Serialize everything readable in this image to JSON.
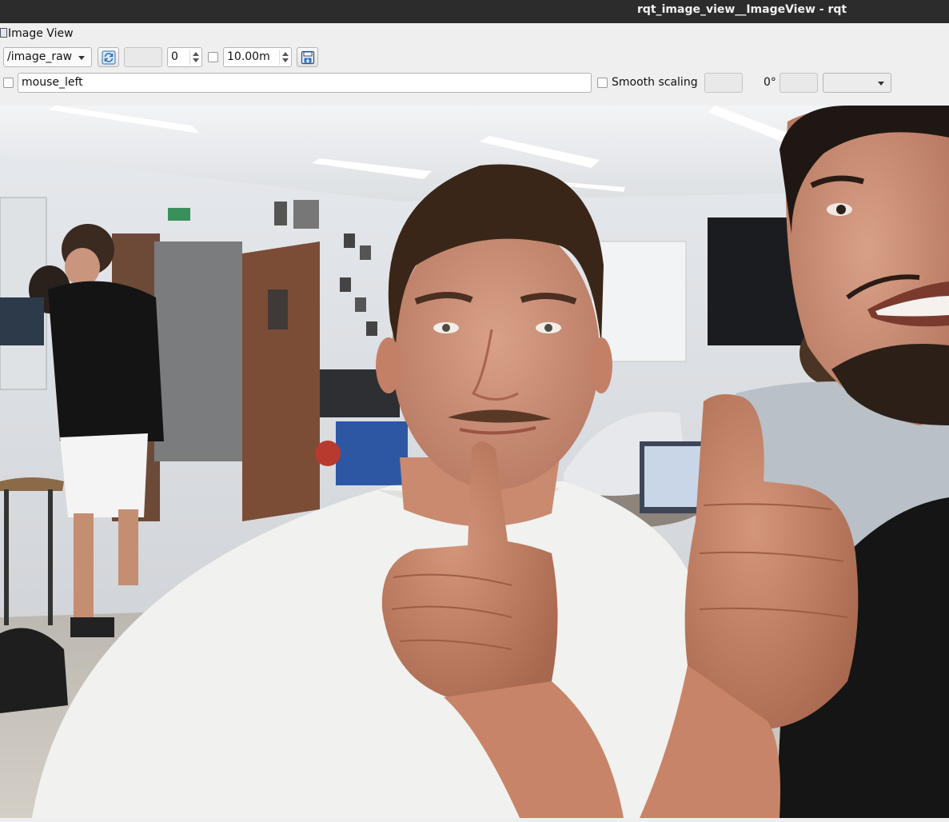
{
  "window": {
    "title": "rqt_image_view__ImageView - rqt"
  },
  "panel": {
    "title": "Image View"
  },
  "toolbar": {
    "topic": "/image_raw",
    "spin_value": "0",
    "rate_value": "10.00m"
  },
  "row2": {
    "mouse_topic": "mouse_left",
    "smooth_scaling_label": "Smooth scaling",
    "rotation_label": "0°"
  },
  "icons": {
    "refresh": "refresh-icon",
    "save": "save-icon",
    "window": "window-icon",
    "dropdown": "chevron-down-icon"
  },
  "colors": {
    "titlebar": "#2c2c2c",
    "panel_bg": "#efefef",
    "accent_blue": "#2a6fbf"
  }
}
